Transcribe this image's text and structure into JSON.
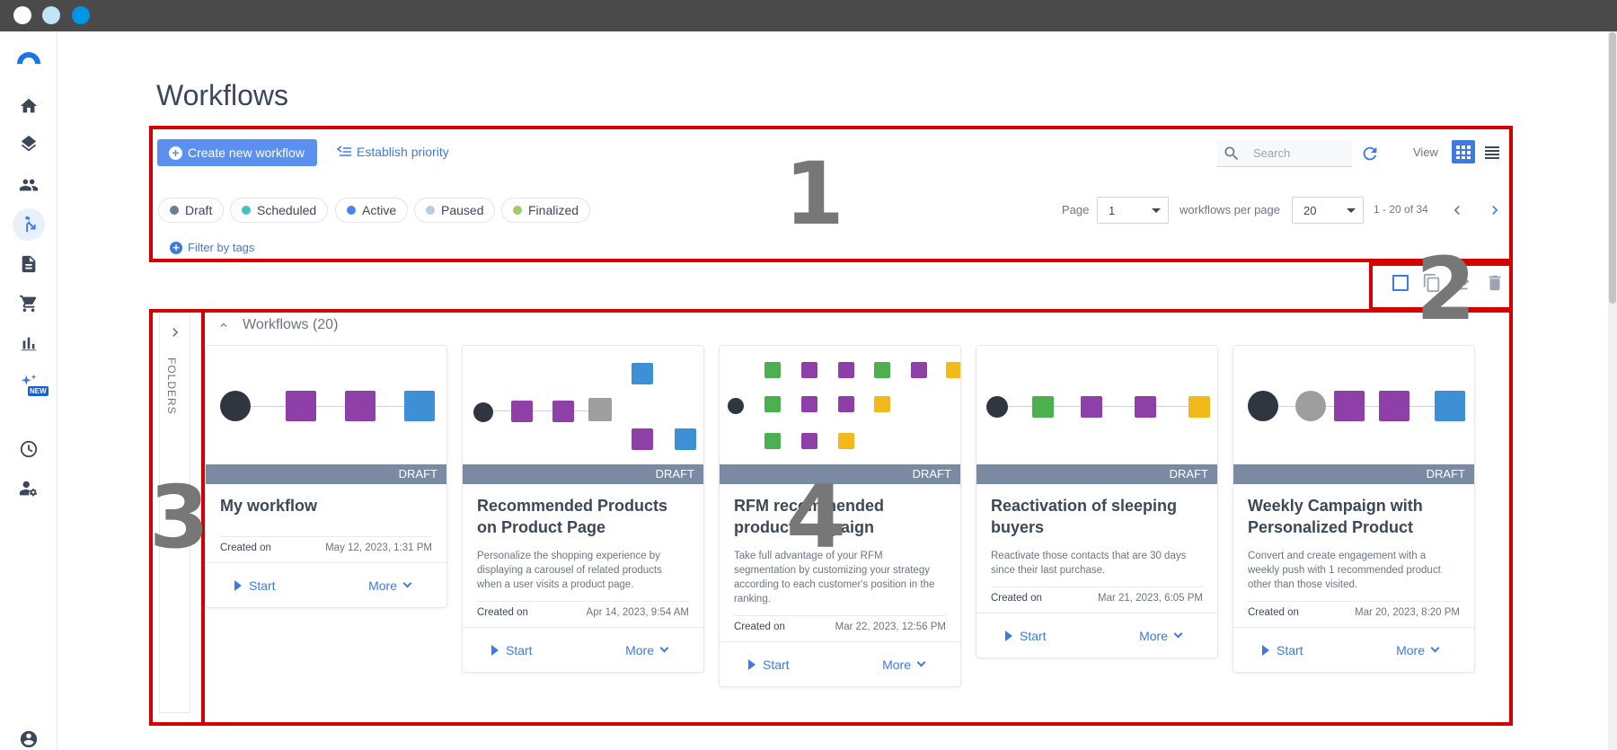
{
  "window": {
    "dot_colors": [
      "#ffffff",
      "#bfe3f7",
      "#0096e6"
    ]
  },
  "sidebar": {
    "items": [
      {
        "icon": "home-icon"
      },
      {
        "icon": "layers-icon"
      },
      {
        "icon": "contacts-icon"
      },
      {
        "icon": "workflow-icon",
        "active": true
      },
      {
        "icon": "document-icon"
      },
      {
        "icon": "cart-icon"
      },
      {
        "icon": "chart-icon"
      },
      {
        "icon": "ai-sparkle-icon",
        "badge": "NEW"
      },
      {
        "icon": "dashboard-icon"
      },
      {
        "icon": "user-settings-icon"
      },
      {
        "icon": "account-icon"
      }
    ]
  },
  "page": {
    "title": "Workflows"
  },
  "toolbar": {
    "create_label": "Create new workflow",
    "priority_label": "Establish priority",
    "filter_tags_label": "Filter by tags",
    "search_placeholder": "Search",
    "view_label": "View"
  },
  "statuses": [
    {
      "label": "Draft",
      "color": "#6b7a99"
    },
    {
      "label": "Scheduled",
      "color": "#3fc3c0"
    },
    {
      "label": "Active",
      "color": "#4a86e8"
    },
    {
      "label": "Paused",
      "color": "#b4cde8"
    },
    {
      "label": "Finalized",
      "color": "#9ccc65"
    }
  ],
  "pagination": {
    "page_label": "Page",
    "page_value": "1",
    "per_page_label": "workflows per page",
    "per_page_value": "20",
    "range_text": "1 - 20 of 34"
  },
  "annotations": {
    "n1": "1",
    "n2": "2",
    "n3": "3",
    "n4": "4"
  },
  "folders": {
    "label": "FOLDERS"
  },
  "group": {
    "header": "Workflows (20)"
  },
  "cards": [
    {
      "status": "DRAFT",
      "title": "My workflow",
      "description": "",
      "created_label": "Created on",
      "created_date": "May 12, 2023, 1:31 PM",
      "start_label": "Start",
      "more_label": "More"
    },
    {
      "status": "DRAFT",
      "title": "Recommended Products on Product Page",
      "description": "Personalize the shopping experience by displaying a carousel of related products when a user visits a product page.",
      "created_label": "Created on",
      "created_date": "Apr 14, 2023, 9:54 AM",
      "start_label": "Start",
      "more_label": "More"
    },
    {
      "status": "DRAFT",
      "title": "RFM recommended product campaign",
      "description": "Take full advantage of your RFM segmentation by customizing your strategy according to each customer's position in the ranking.",
      "created_label": "Created on",
      "created_date": "Mar 22, 2023, 12:56 PM",
      "start_label": "Start",
      "more_label": "More"
    },
    {
      "status": "DRAFT",
      "title": "Reactivation of sleeping buyers",
      "description": "Reactivate those contacts that are 30 days since their last purchase.",
      "created_label": "Created on",
      "created_date": "Mar 21, 2023, 6:05 PM",
      "start_label": "Start",
      "more_label": "More"
    },
    {
      "status": "DRAFT",
      "title": "Weekly Campaign with Personalized Product",
      "description": "Convert and create engagement with a weekly push with 1 recommended product other than those visited.",
      "created_label": "Created on",
      "created_date": "Mar 20, 2023, 8:20 PM",
      "start_label": "Start",
      "more_label": "More"
    }
  ],
  "colors": {
    "accent": "#3d7be0",
    "primary_button": "#5b8ff0",
    "annotation_red": "#d50000",
    "draft_bar": "#7b8aa3",
    "node_purple": "#8e3fa8",
    "node_blue": "#3d8fd6",
    "node_green": "#4caf50",
    "node_yellow": "#f2b91a",
    "node_dark": "#2f3640",
    "node_gray": "#9e9e9e"
  }
}
